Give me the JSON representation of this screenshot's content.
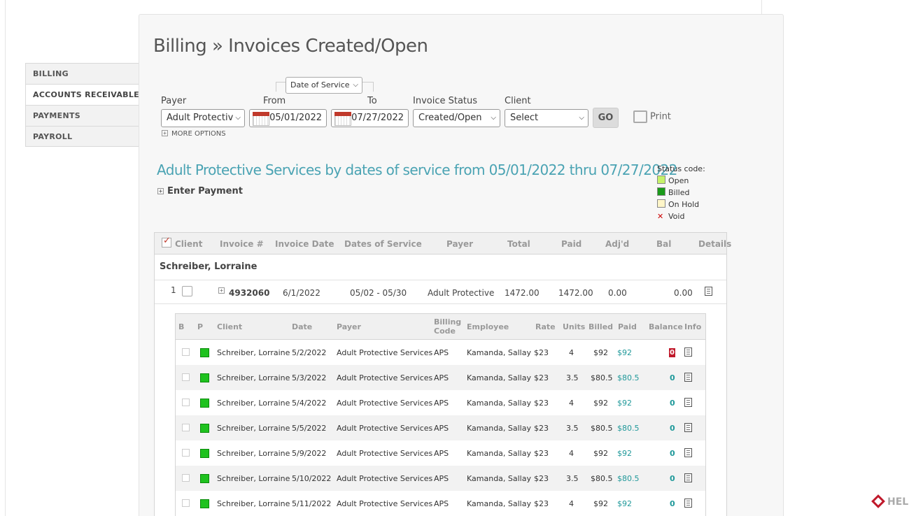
{
  "sidebar": {
    "items": [
      {
        "label": "BILLING"
      },
      {
        "label": "ACCOUNTS RECEIVABLE"
      },
      {
        "label": "PAYMENTS"
      },
      {
        "label": "PAYROLL"
      }
    ]
  },
  "header": {
    "title": "Billing » Invoices  Created/Open"
  },
  "filters": {
    "date_type": "Date of Service",
    "payer_label": "Payer",
    "payer_value": "Adult Protectiv",
    "from_label": "From",
    "from_value": "05/01/2022",
    "to_label": "To",
    "to_value": "07/27/2022",
    "status_label": "Invoice Status",
    "status_value": "Created/Open",
    "client_label": "Client",
    "client_value": "Select",
    "go_label": "GO",
    "print_label": "Print",
    "more_options": "MORE OPTIONS"
  },
  "section": {
    "title": "Adult Protective Services by dates of service from 05/01/2022 thru 07/27/2022",
    "enter_payment": "Enter Payment"
  },
  "legend": {
    "title": "Status code:",
    "items": [
      {
        "label": "Open",
        "color": "#c6f26a"
      },
      {
        "label": "Billed",
        "color": "#1a9a1a"
      },
      {
        "label": "On Hold",
        "color": "#fff6c8"
      },
      {
        "label": "Void",
        "color": "#cc0000"
      }
    ]
  },
  "main_table": {
    "headers": [
      "Client",
      "Invoice #",
      "Invoice Date",
      "Dates of Service",
      "Payer",
      "Total",
      "Paid",
      "Adj'd",
      "Bal",
      "Details"
    ],
    "client_group": "Schreiber, Lorraine",
    "invoice_row": {
      "index": "1",
      "invoice_no": "4932060",
      "invoice_date": "6/1/2022",
      "dates": "05/02  -  05/30",
      "payer": "Adult Protective",
      "total": "1472.00",
      "paid": "1472.00",
      "adjd": "0.00",
      "bal": "0.00"
    }
  },
  "sub_table": {
    "headers": {
      "b": "B",
      "p": "P",
      "client": "Client",
      "date": "Date",
      "payer": "Payer",
      "billing_code_1": "Billing",
      "billing_code_2": "Code",
      "employee": "Employee",
      "rate": "Rate",
      "units": "Units",
      "billed": "Billed",
      "paid": "Paid",
      "balance": "Balance",
      "info": "Info"
    },
    "rows": [
      {
        "client": "Schreiber, Lorraine",
        "date": "5/2/2022",
        "payer": "Adult Protective Services",
        "code": "APS",
        "employee": "Kamanda, Sallay",
        "rate": "$23",
        "units": "4",
        "billed": "$92",
        "paid": "$92",
        "balance": "0"
      },
      {
        "client": "Schreiber, Lorraine",
        "date": "5/3/2022",
        "payer": "Adult Protective Services",
        "code": "APS",
        "employee": "Kamanda, Sallay",
        "rate": "$23",
        "units": "3.5",
        "billed": "$80.5",
        "paid": "$80.5",
        "balance": "0"
      },
      {
        "client": "Schreiber, Lorraine",
        "date": "5/4/2022",
        "payer": "Adult Protective Services",
        "code": "APS",
        "employee": "Kamanda, Sallay",
        "rate": "$23",
        "units": "4",
        "billed": "$92",
        "paid": "$92",
        "balance": "0"
      },
      {
        "client": "Schreiber, Lorraine",
        "date": "5/5/2022",
        "payer": "Adult Protective Services",
        "code": "APS",
        "employee": "Kamanda, Sallay",
        "rate": "$23",
        "units": "3.5",
        "billed": "$80.5",
        "paid": "$80.5",
        "balance": "0"
      },
      {
        "client": "Schreiber, Lorraine",
        "date": "5/9/2022",
        "payer": "Adult Protective Services",
        "code": "APS",
        "employee": "Kamanda, Sallay",
        "rate": "$23",
        "units": "4",
        "billed": "$92",
        "paid": "$92",
        "balance": "0"
      },
      {
        "client": "Schreiber, Lorraine",
        "date": "5/10/2022",
        "payer": "Adult Protective Services",
        "code": "APS",
        "employee": "Kamanda, Sallay",
        "rate": "$23",
        "units": "3.5",
        "billed": "$80.5",
        "paid": "$80.5",
        "balance": "0"
      },
      {
        "client": "Schreiber, Lorraine",
        "date": "5/11/2022",
        "payer": "Adult Protective Services",
        "code": "APS",
        "employee": "Kamanda, Sallay",
        "rate": "$23",
        "units": "4",
        "billed": "$92",
        "paid": "$92",
        "balance": "0"
      }
    ]
  },
  "help": {
    "label": "HEL"
  }
}
